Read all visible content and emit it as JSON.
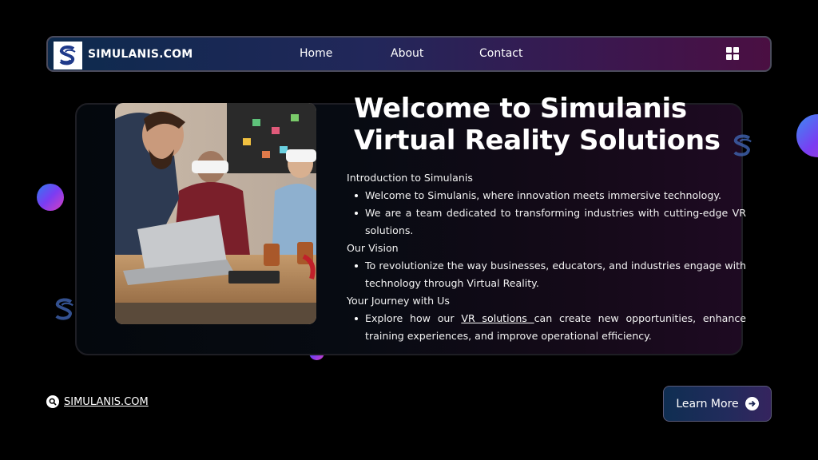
{
  "nav": {
    "brand": "SIMULANIS.COM",
    "links": [
      "Home",
      "About",
      "Contact"
    ],
    "menu_icon": "grid-icon"
  },
  "hero": {
    "title": "Welcome to Simulanis Virtual Reality Solutions",
    "sections": [
      {
        "heading": "Introduction to Simulanis",
        "bullets": [
          "Welcome to Simulanis, where innovation meets immersive technology.",
          "We are a team dedicated to transforming industries with cutting-edge VR solutions."
        ]
      },
      {
        "heading": "Our Vision",
        "bullets": [
          "To revolutionize the way businesses, educators, and industries engage with technology through Virtual Reality."
        ]
      },
      {
        "heading": "Your Journey with Us",
        "bullet_prefix": "Explore how our ",
        "bullet_link": "VR solutions ",
        "bullet_suffix": "can create new opportunities, enhance training experiences, and improve operational efficiency."
      }
    ]
  },
  "footer": {
    "site_link": "SIMULANIS.COM",
    "cta_label": "Learn More"
  },
  "colors": {
    "accent_blue": "#2f7bf0",
    "accent_purple": "#7a3df2",
    "accent_pink": "#d73fc0",
    "background": "#000000"
  }
}
